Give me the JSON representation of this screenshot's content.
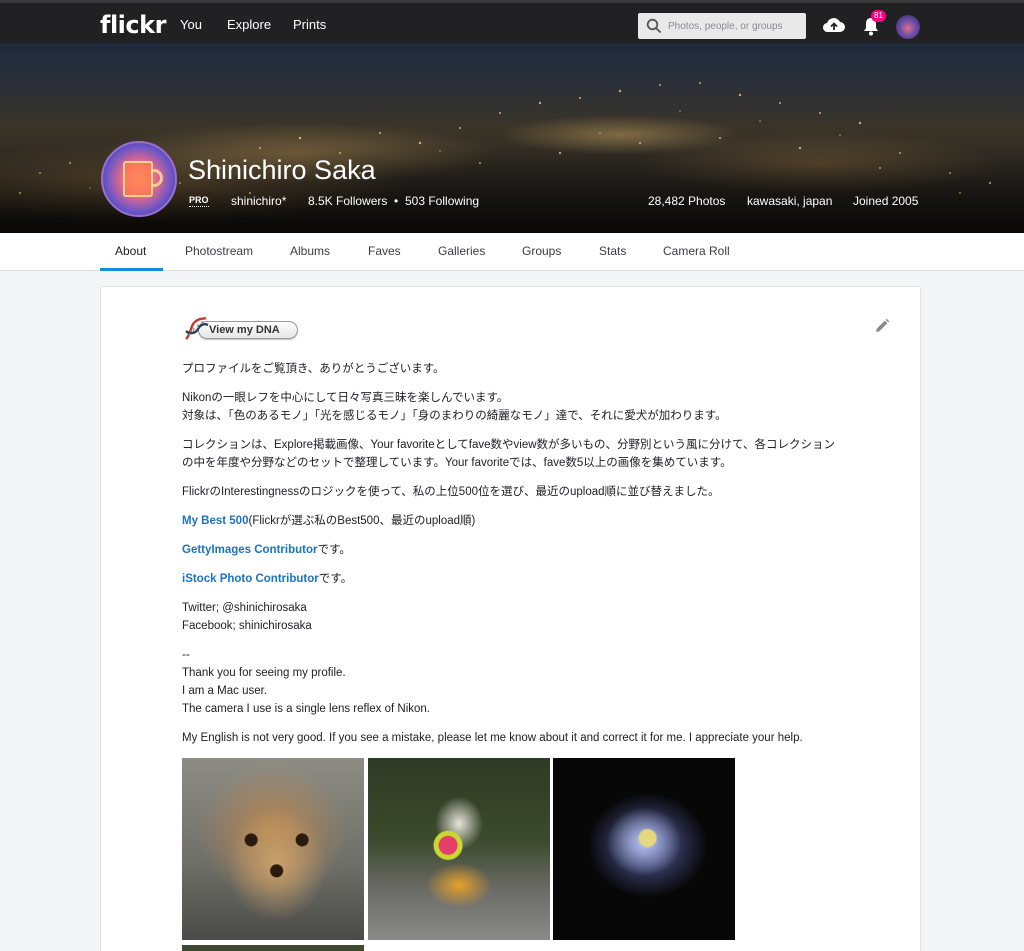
{
  "topbar": {
    "logo": "flickr",
    "nav": [
      "You",
      "Explore",
      "Prints"
    ],
    "search_placeholder": "Photos, people, or groups",
    "notifications_count": "81"
  },
  "profile": {
    "name": "Shinichiro Saka",
    "pro": "PRO",
    "username": "shinichiro*",
    "followers": "8.5K Followers",
    "following": "503 Following",
    "photos": "28,482 Photos",
    "location": "kawasaki, japan",
    "joined": "Joined 2005"
  },
  "tabs": [
    "About",
    "Photostream",
    "Albums",
    "Faves",
    "Galleries",
    "Groups",
    "Stats",
    "Camera Roll"
  ],
  "about": {
    "dna_button": "View my DNA",
    "p1": "プロファイルをご覧頂き、ありがとうございます。",
    "p2a": "Nikonの一眼レフを中心にして日々写真三昧を楽しんでいます。",
    "p2b": "対象は、「色のあるモノ」「光を感じるモノ」「身のまわりの綺麗なモノ」達で、それに愛犬が加わります。",
    "p3": "コレクションは、Explore掲載画像、Your favoriteとしてfave数やview数が多いもの、分野別という風に分けて、各コレクションの中を年度や分野などのセットで整理しています。Your favoriteでは、fave数5以上の画像を集めています。",
    "p4": "FlickrのInterestingnessのロジックを使って、私の上位500位を選び、最近のupload順に並び替えました。",
    "link1": "My Best 500",
    "link1_rest": "(Flickrが選ぶ私のBest500、最近のupload順)",
    "link2": "GettyImages Contributor",
    "link2_rest": "です。",
    "link3": "iStock Photo Contributor",
    "link3_rest": "です。",
    "twitter": "Twitter; @shinichirosaka",
    "facebook": "Facebook; shinichirosaka",
    "sep": "--",
    "en1": "Thank you for seeing my profile.",
    "en2": "I am a Mac user.",
    "en3": "The camera I use is a single lens reflex of Nikon.",
    "en4": "My English is not very good. If you see a mistake, please let me know about it and correct it for me. I appreciate your help."
  },
  "colors": {
    "accent": "#128fdc",
    "link": "#1c73bf",
    "badge": "#ff0084"
  }
}
